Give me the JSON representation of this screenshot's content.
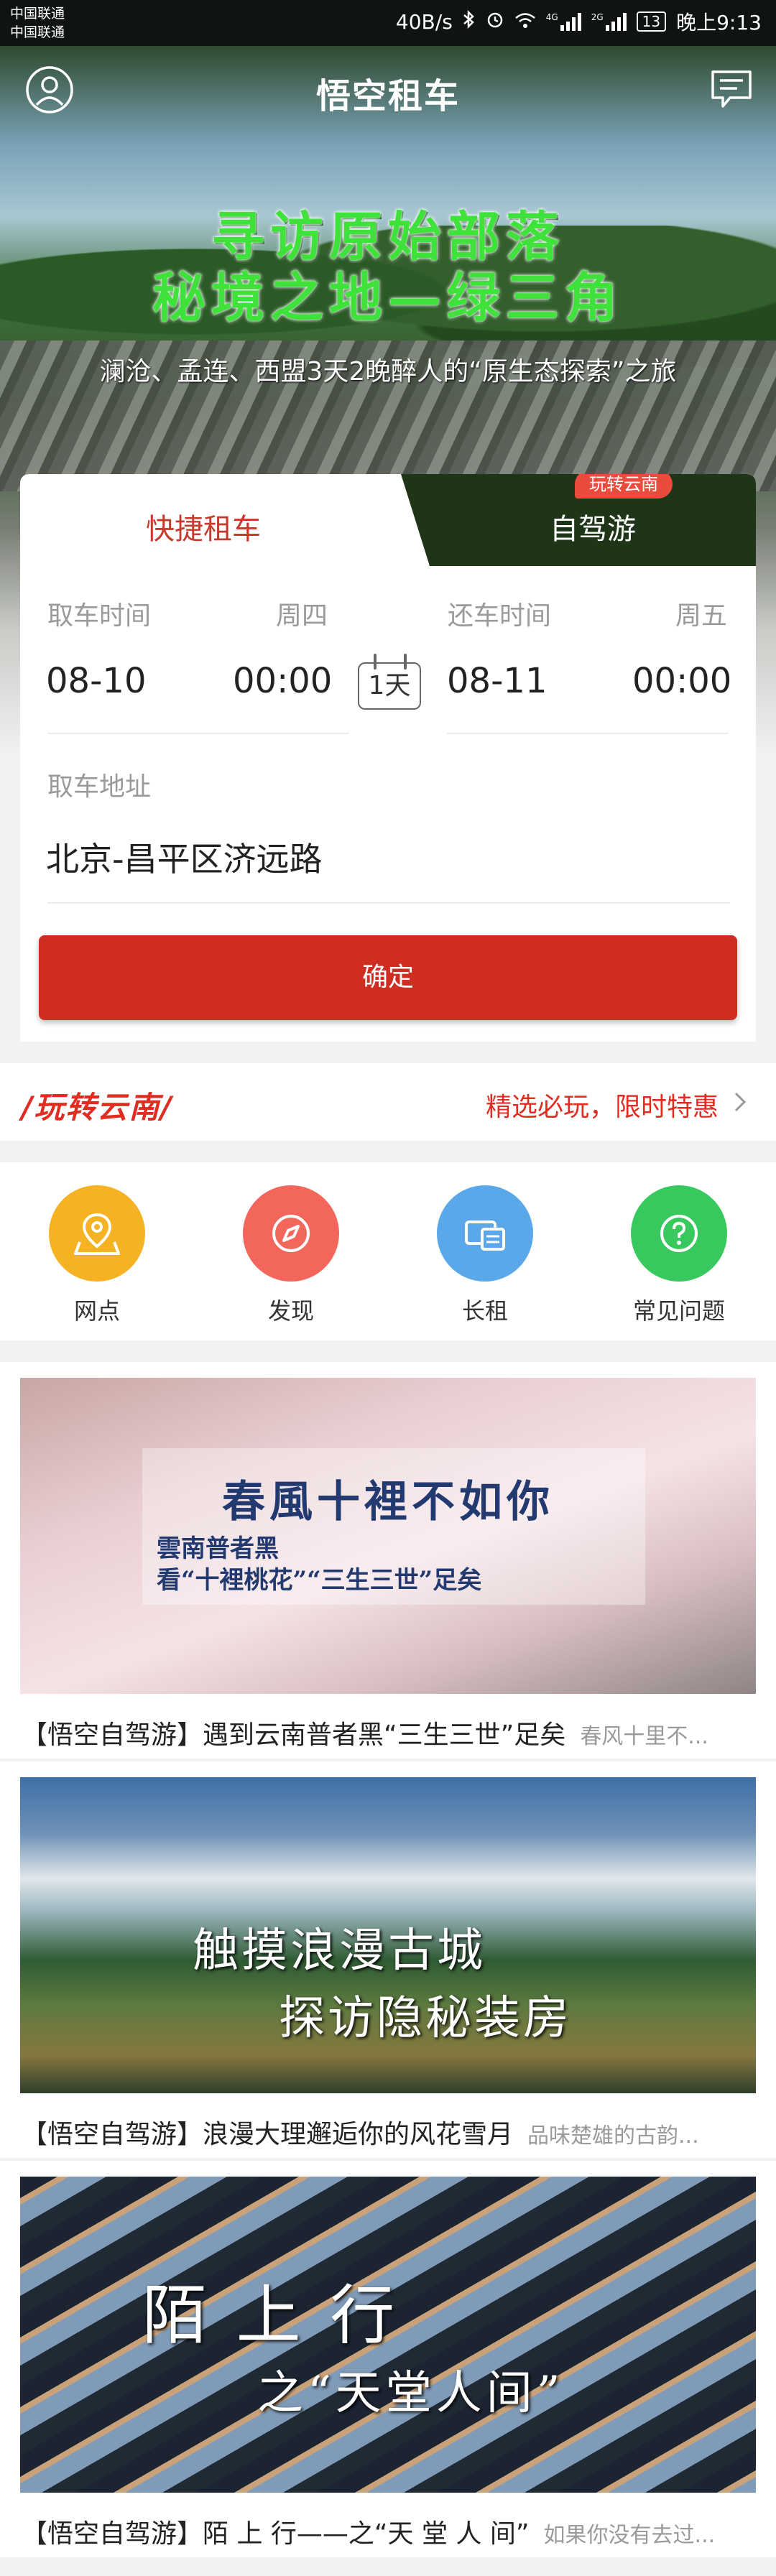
{
  "status_bar": {
    "carrier1": "中国联通",
    "carrier2": "中国联通",
    "speed": "40B/s",
    "sig1_label": "4G",
    "sig2_label": "2G",
    "battery": "13",
    "time": "晚上9:13"
  },
  "app": {
    "title": "悟空租车",
    "user_icon": "user-circle-icon",
    "message_icon": "message-icon"
  },
  "banner": {
    "line1": "寻访原始部落",
    "line2": "秘境之地—绿三角",
    "subtitle": "澜沧、孟连、西盟3天2晚醉人的“原生态探索”之旅"
  },
  "booking": {
    "tab_quick": "快捷租车",
    "tab_self": "自驾游",
    "tab_self_badge": "玩转云南",
    "pickup_label": "取车时间",
    "pickup_weekday": "周四",
    "pickup_date": "08-10",
    "pickup_time": "00:00",
    "days": "1天",
    "return_label": "还车时间",
    "return_weekday": "周五",
    "return_date": "08-11",
    "return_time": "00:00",
    "address_label": "取车地址",
    "address_value": "北京-昌平区济远路",
    "confirm": "确定"
  },
  "promo": {
    "logo": "/玩转云南/",
    "text": "精选必玩，限时特惠",
    "arrow_icon": "chevron-right-icon"
  },
  "quick_icons": [
    {
      "label": "网点",
      "icon": "map-pin-icon",
      "color": "#f5b324"
    },
    {
      "label": "发现",
      "icon": "compass-icon",
      "color": "#f2665b"
    },
    {
      "label": "长租",
      "icon": "calendar-card-icon",
      "color": "#5aa8ea"
    },
    {
      "label": "常见问题",
      "icon": "question-icon",
      "color": "#37c95d"
    }
  ],
  "articles": [
    {
      "title": "【悟空自驾游】遇到云南普者黑“三生三世”足矣",
      "subtitle": "春风十里不...",
      "img_line1": "春風十裡不如你",
      "img_line2": "雲南普者黑",
      "img_line3": "看“十裡桃花”“三生三世”足矣"
    },
    {
      "title": "【悟空自驾游】浪漫大理邂逅你的风花雪月",
      "subtitle": "品味楚雄的古韵...",
      "img_line1": "触摸浪漫古城",
      "img_line2": "探访隐秘装房"
    },
    {
      "title": "【悟空自驾游】陌 上 行——之“天 堂 人 间”",
      "subtitle": "如果你没有去过...",
      "img_line1": "陌  上  行",
      "img_line2": "之“天堂人间”"
    }
  ]
}
